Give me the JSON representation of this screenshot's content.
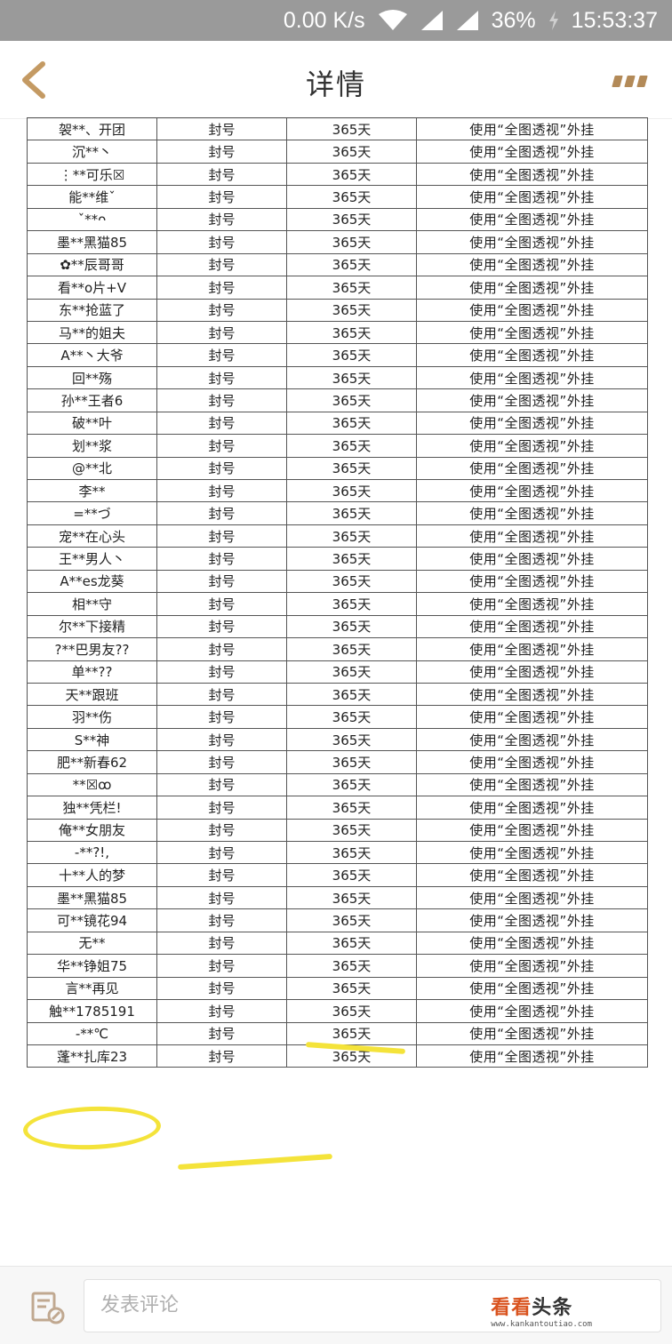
{
  "status_bar": {
    "speed": "0.00 K/s",
    "battery": "36%",
    "time": "15:53:37"
  },
  "header": {
    "title": "详情"
  },
  "table": {
    "rows": [
      [
        "袈**、开团",
        "封号",
        "365天",
        "使用“全图透视”外挂"
      ],
      [
        "沉**丶",
        "封号",
        "365天",
        "使用“全图透视”外挂"
      ],
      [
        "⋮**可乐☒",
        "封号",
        "365天",
        "使用“全图透视”外挂"
      ],
      [
        "能**维ˇ",
        "封号",
        "365天",
        "使用“全图透视”外挂"
      ],
      [
        "ˇ**ᴖ",
        "封号",
        "365天",
        "使用“全图透视”外挂"
      ],
      [
        "墨**黑猫85",
        "封号",
        "365天",
        "使用“全图透视”外挂"
      ],
      [
        "✿**辰哥哥",
        "封号",
        "365天",
        "使用“全图透视”外挂"
      ],
      [
        "看**o片+V",
        "封号",
        "365天",
        "使用“全图透视”外挂"
      ],
      [
        "东**抢蓝了",
        "封号",
        "365天",
        "使用“全图透视”外挂"
      ],
      [
        "马**的姐夫",
        "封号",
        "365天",
        "使用“全图透视”外挂"
      ],
      [
        "A**丶大爷",
        "封号",
        "365天",
        "使用“全图透视”外挂"
      ],
      [
        "回**殇",
        "封号",
        "365天",
        "使用“全图透视”外挂"
      ],
      [
        "孙**王者6",
        "封号",
        "365天",
        "使用“全图透视”外挂"
      ],
      [
        "破**叶",
        "封号",
        "365天",
        "使用“全图透视”外挂"
      ],
      [
        "划**浆",
        "封号",
        "365天",
        "使用“全图透视”外挂"
      ],
      [
        "@**北",
        "封号",
        "365天",
        "使用“全图透视”外挂"
      ],
      [
        "李**",
        "封号",
        "365天",
        "使用“全图透视”外挂"
      ],
      [
        "=**づ",
        "封号",
        "365天",
        "使用“全图透视”外挂"
      ],
      [
        "宠**在心头",
        "封号",
        "365天",
        "使用“全图透视”外挂"
      ],
      [
        "王**男人丶",
        "封号",
        "365天",
        "使用“全图透视”外挂"
      ],
      [
        "A**es龙葵",
        "封号",
        "365天",
        "使用“全图透视”外挂"
      ],
      [
        "相**守",
        "封号",
        "365天",
        "使用“全图透视”外挂"
      ],
      [
        "尔**下接精",
        "封号",
        "365天",
        "使用“全图透视”外挂"
      ],
      [
        "?**巴男友??",
        "封号",
        "365天",
        "使用“全图透视”外挂"
      ],
      [
        "单**??",
        "封号",
        "365天",
        "使用“全图透视”外挂"
      ],
      [
        "天**跟班",
        "封号",
        "365天",
        "使用“全图透视”外挂"
      ],
      [
        "羽**伤",
        "封号",
        "365天",
        "使用“全图透视”外挂"
      ],
      [
        "S**神",
        "封号",
        "365天",
        "使用“全图透视”外挂"
      ],
      [
        "肥**新春62",
        "封号",
        "365天",
        "使用“全图透视”外挂"
      ],
      [
        "**☒ꝏ",
        "封号",
        "365天",
        "使用“全图透视”外挂"
      ],
      [
        "独**凭栏!",
        "封号",
        "365天",
        "使用“全图透视”外挂"
      ],
      [
        "俺**女朋友",
        "封号",
        "365天",
        "使用“全图透视”外挂"
      ],
      [
        "-**?!,",
        "封号",
        "365天",
        "使用“全图透视”外挂"
      ],
      [
        "十**人的梦",
        "封号",
        "365天",
        "使用“全图透视”外挂"
      ],
      [
        "墨**黑猫85",
        "封号",
        "365天",
        "使用“全图透视”外挂"
      ],
      [
        "可**镜花94",
        "封号",
        "365天",
        "使用“全图透视”外挂"
      ],
      [
        "无**",
        "封号",
        "365天",
        "使用“全图透视”外挂"
      ],
      [
        "华**铮姐75",
        "封号",
        "365天",
        "使用“全图透视”外挂"
      ],
      [
        "言**再见",
        "封号",
        "365天",
        "使用“全图透视”外挂"
      ],
      [
        "触**1785191",
        "封号",
        "365天",
        "使用“全图透视”外挂"
      ],
      [
        "-**℃",
        "封号",
        "365天",
        "使用“全图透视”外挂"
      ],
      [
        "蓬**扎库23",
        "封号",
        "365天",
        "使用“全图透视”外挂"
      ]
    ]
  },
  "bottom_bar": {
    "comment_placeholder": "发表评论",
    "watermark_main": "看看",
    "watermark_sub": "头条",
    "watermark_url": "www.kankantoutiao.com"
  },
  "colors": {
    "status_bar_bg": "#9a9a9a",
    "accent_gold": "#b38a58",
    "highlight_yellow": "#f4e33a",
    "watermark_orange": "#d9531e"
  }
}
